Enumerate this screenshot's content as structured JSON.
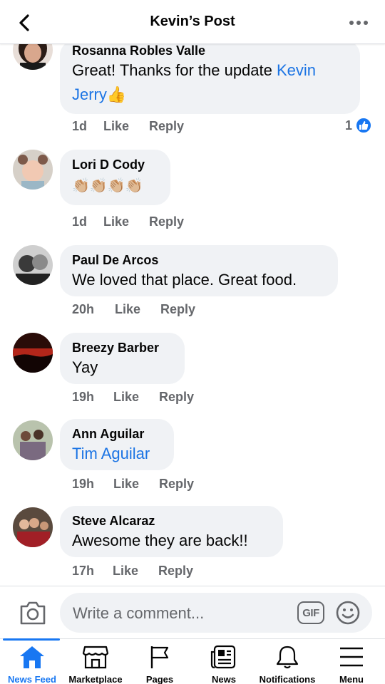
{
  "header": {
    "title": "Kevin’s Post"
  },
  "comments": [
    {
      "author": "Rosanna Robles Valle",
      "text": "Great! Thanks for the update ",
      "mention": "Kevin Jerry",
      "emoji": "👍",
      "time": "1d",
      "like_label": "Like",
      "reply_label": "Reply",
      "reaction_count": "1"
    },
    {
      "author": "Lori D Cody",
      "text": "👏🏼👏🏼👏🏼👏🏼",
      "time": "1d",
      "like_label": "Like",
      "reply_label": "Reply"
    },
    {
      "author": "Paul De Arcos",
      "text": "We loved that place. Great food.",
      "time": "20h",
      "like_label": "Like",
      "reply_label": "Reply"
    },
    {
      "author": "Breezy Barber",
      "text": "Yay",
      "time": "19h",
      "like_label": "Like",
      "reply_label": "Reply"
    },
    {
      "author": "Ann Aguilar",
      "mention": "Tim Aguilar",
      "time": "19h",
      "like_label": "Like",
      "reply_label": "Reply"
    },
    {
      "author": "Steve Alcaraz",
      "text": "Awesome they are back!!",
      "time": "17h",
      "like_label": "Like",
      "reply_label": "Reply"
    }
  ],
  "composer": {
    "placeholder": "Write a comment...",
    "gif_label": "GIF"
  },
  "tabs": [
    {
      "label": "News Feed",
      "icon": "home-icon",
      "active": true
    },
    {
      "label": "Marketplace",
      "icon": "shop-icon",
      "active": false
    },
    {
      "label": "Pages",
      "icon": "flag-icon",
      "active": false
    },
    {
      "label": "News",
      "icon": "newspaper-icon",
      "active": false
    },
    {
      "label": "Notifications",
      "icon": "bell-icon",
      "active": false
    },
    {
      "label": "Menu",
      "icon": "menu-icon",
      "active": false
    }
  ],
  "colors": {
    "accent": "#1877f2",
    "mention": "#1b74e4",
    "bubble": "#f0f2f5",
    "meta_text": "#65676b"
  }
}
